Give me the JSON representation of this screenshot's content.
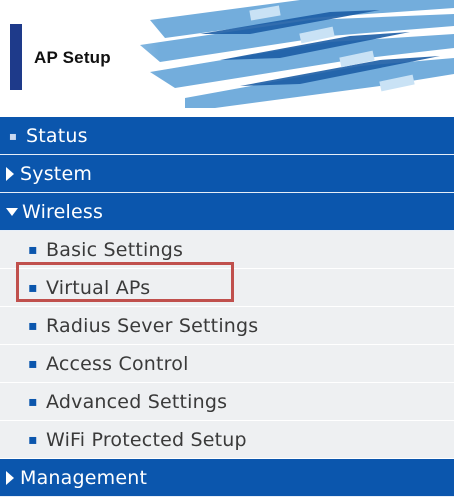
{
  "header": {
    "title": "AP Setup"
  },
  "menu": {
    "status": "Status",
    "system": "System",
    "wireless": "Wireless",
    "wireless_items": [
      "Basic Settings",
      "Virtual APs",
      "Radius Sever Settings",
      "Access Control",
      "Advanced Settings",
      "WiFi Protected Setup"
    ],
    "management": "Management"
  },
  "colors": {
    "menu_blue": "#0b56ad",
    "submenu_bg": "#eef0f2",
    "highlight_border": "#c0504d"
  }
}
